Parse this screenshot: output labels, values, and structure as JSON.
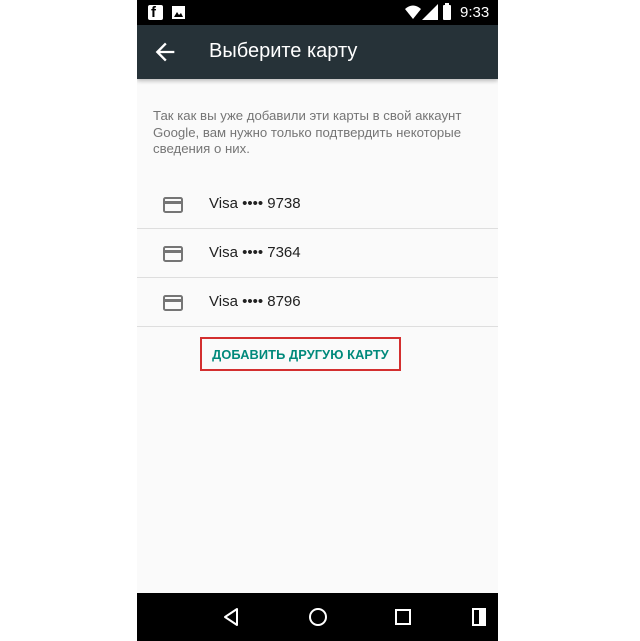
{
  "status_bar": {
    "time": "9:33",
    "icons": [
      "facebook-icon",
      "image-icon",
      "wifi-icon",
      "signal-icon",
      "battery-icon"
    ]
  },
  "app_bar": {
    "title": "Выберите карту",
    "back_icon": "arrow-back-icon",
    "background": "#263238"
  },
  "content": {
    "description": "Так как вы уже добавили эти карты в свой аккаунт Google, вам нужно только подтвердить некоторые сведения о них.",
    "cards": [
      {
        "label": "Visa •••• 9738",
        "icon": "credit-card-icon"
      },
      {
        "label": "Visa •••• 7364",
        "icon": "credit-card-icon"
      },
      {
        "label": "Visa •••• 8796",
        "icon": "credit-card-icon"
      }
    ],
    "add_card_button": "ДОБАВИТЬ ДРУГУЮ КАРТУ",
    "accent_color": "#00897b",
    "highlight_color": "#d32f2f"
  },
  "nav_bar": {
    "buttons": [
      "back-triangle-icon",
      "home-circle-icon",
      "recents-square-icon",
      "split-screen-icon"
    ]
  }
}
